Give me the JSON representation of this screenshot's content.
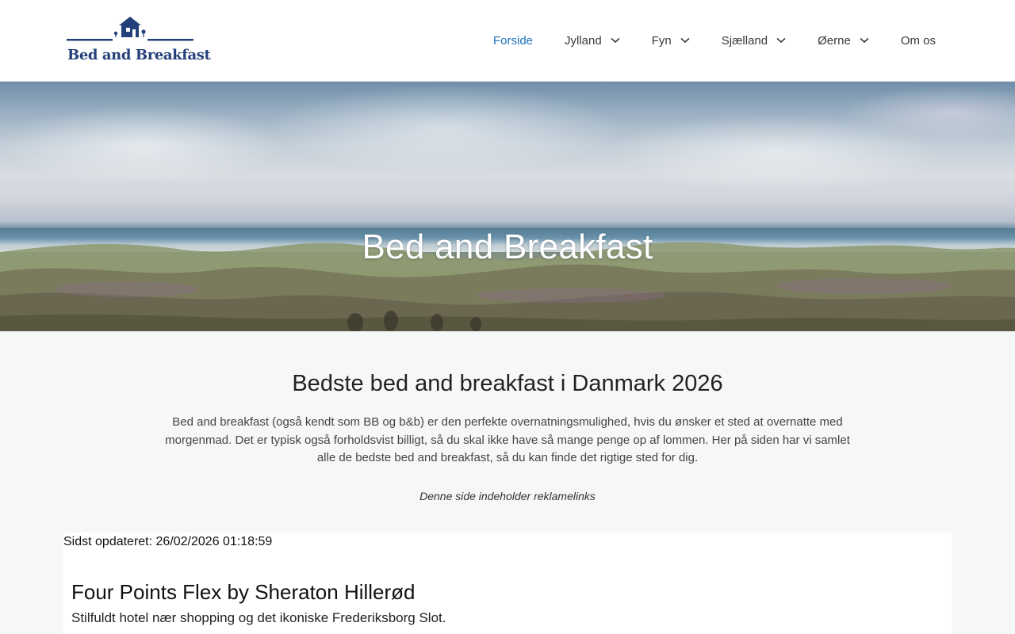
{
  "header": {
    "logo_text": "Bed and Breakfast",
    "nav": [
      {
        "label": "Forside",
        "active": true,
        "has_dropdown": false
      },
      {
        "label": "Jylland",
        "active": false,
        "has_dropdown": true
      },
      {
        "label": "Fyn",
        "active": false,
        "has_dropdown": true
      },
      {
        "label": "Sjælland",
        "active": false,
        "has_dropdown": true
      },
      {
        "label": "Øerne",
        "active": false,
        "has_dropdown": true
      },
      {
        "label": "Om os",
        "active": false,
        "has_dropdown": false
      }
    ]
  },
  "hero": {
    "title": "Bed and Breakfast"
  },
  "intro": {
    "title": "Bedste bed and breakfast i Danmark 2026",
    "text": "Bed and breakfast (også kendt som BB og b&b) er den perfekte overnatningsmulighed, hvis du ønsker et sted at overnatte med morgenmad. Det er typisk også forholdsvist billigt, så du skal ikke have så mange penge op af lommen. Her på siden har vi samlet alle de bedste bed and breakfast, så du kan finde det rigtige sted for dig.",
    "ad_note": "Denne side indeholder reklamelinks"
  },
  "listing": {
    "updated": "Sidst opdateret: 26/02/2026 01:18:59",
    "hotel_name": "Four Points Flex by Sheraton Hillerød",
    "hotel_description": "Stilfuldt hotel nær shopping og det ikoniske Frederiksborg Slot."
  },
  "colors": {
    "brand_blue": "#24407a",
    "nav_active": "#1e72bd",
    "page_background": "#f6f7f9"
  },
  "icons": {
    "logo": "house-icon",
    "dropdown": "chevron-down-icon"
  }
}
